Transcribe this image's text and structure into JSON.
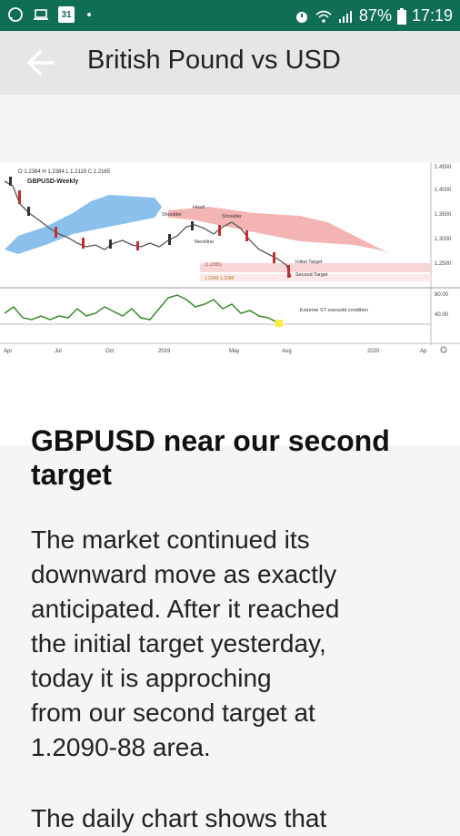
{
  "status_bar": {
    "battery": "87%",
    "time": "17:19",
    "calendar_day": "31"
  },
  "appbar": {
    "title": "British Pound vs USD"
  },
  "chart": {
    "ohlc": "O 1.2384  H 1.2384  L 1.2119  C 1.2165",
    "symbol": "GBPUSD-Weekly",
    "y_ticks": [
      "1.4500",
      "1.4000",
      "1.3500",
      "1.3000",
      "1.2500",
      "80.00",
      "40.00"
    ],
    "x_ticks": [
      "Apr",
      "Jul",
      "Oct",
      "2019",
      "May",
      "Aug",
      "2020",
      "Ap"
    ],
    "annotations": [
      "Head",
      "Shoulder",
      "Shoulder",
      "Neckline",
      "Initial Target",
      "Second Target",
      "Extreme ST oversold condition",
      "(1.2305)",
      "1.2090-1.2088"
    ]
  },
  "article": {
    "heading": "GBPUSD near our second target",
    "paragraph": "The market continued its\ndownward move as exactly\nanticipated. After it reached\nthe initial target yesterday,\ntoday it is approching\nfrom our second target at\n1.2090-88 area.",
    "paragraph2": "The daily chart shows that"
  }
}
